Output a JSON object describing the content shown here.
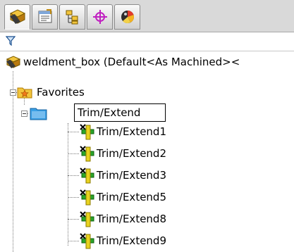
{
  "tabs": [
    {
      "icon": "feature-manager-icon",
      "active": true
    },
    {
      "icon": "property-manager-icon",
      "active": false
    },
    {
      "icon": "configuration-manager-icon",
      "active": false
    },
    {
      "icon": "dimxpert-manager-icon",
      "active": false
    },
    {
      "icon": "display-manager-icon",
      "active": false
    }
  ],
  "filter": {
    "icon": "filter-icon"
  },
  "tree": {
    "root_label": "weldment_box (Default<As Machined><",
    "favorites_label": "Favorites",
    "folder_value": "Trim/Extend",
    "items": [
      "Trim/Extend1",
      "Trim/Extend2",
      "Trim/Extend3",
      "Trim/Extend5",
      "Trim/Extend8",
      "Trim/Extend9"
    ]
  },
  "colors": {
    "accent_blue": "#1a6fd1",
    "folder_blue": "#3aa0e6",
    "favorites_gold": "#f2c53d",
    "trim_green": "#2aa52a",
    "trim_yellow": "#e8d21f"
  }
}
